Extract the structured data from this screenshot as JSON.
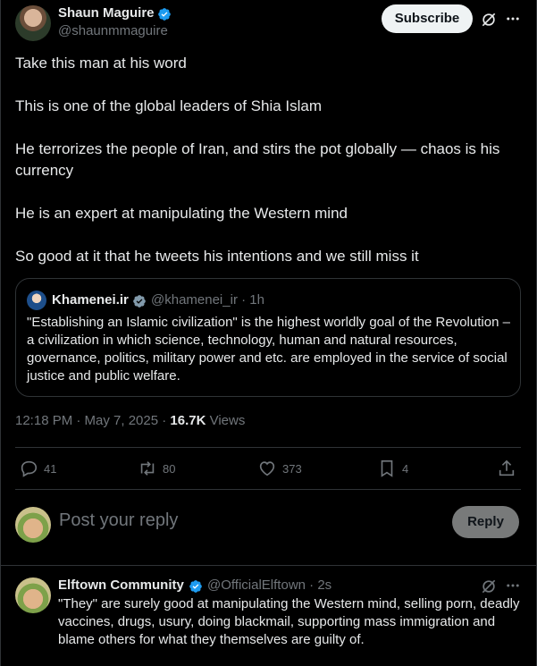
{
  "tweet": {
    "author_name": "Shaun Maguire",
    "author_handle": "@shaunmmaguire",
    "subscribe_label": "Subscribe",
    "paragraphs": [
      "Take this man at his word",
      "This is one of the global leaders of Shia Islam",
      "He terrorizes the people of Iran, and stirs the pot globally — chaos is his currency",
      "He is an expert at manipulating the Western mind",
      "So good at it that he tweets his intentions and we still miss it"
    ],
    "time": "12:18 PM · May 7, 2025 · ",
    "views_count": "16.7K",
    "views_label": " Views"
  },
  "quote": {
    "author_name": "Khamenei.ir",
    "author_handle": "@khamenei_ir · 1h",
    "text": "\"Establishing an Islamic civilization\" is the highest worldly goal of the Revolution – a civilization in which science, technology, human and natural resources, governance, politics, military power and etc. are employed in the service of social justice and public welfare."
  },
  "actions": {
    "replies": "41",
    "reposts": "80",
    "likes": "373",
    "bookmarks": "4"
  },
  "composer": {
    "placeholder": "Post your reply",
    "reply_label": "Reply"
  },
  "reply": {
    "author_name": "Elftown Community",
    "author_handle": "@OfficialElftown · 2s",
    "text": "\"They\" are surely good at manipulating the Western mind, selling porn, deadly vaccines, drugs, usury, doing blackmail, supporting mass immigration and blame others for what they themselves are guilty of."
  },
  "colors": {
    "background": "#000000",
    "text": "#e7e9ea",
    "muted": "#71767b",
    "border": "#2f3336",
    "verified": "#1d9bf0"
  },
  "icons": [
    "verified-badge-icon",
    "grok-icon",
    "more-icon",
    "reply-icon",
    "repost-icon",
    "like-icon",
    "bookmark-icon",
    "share-icon"
  ]
}
